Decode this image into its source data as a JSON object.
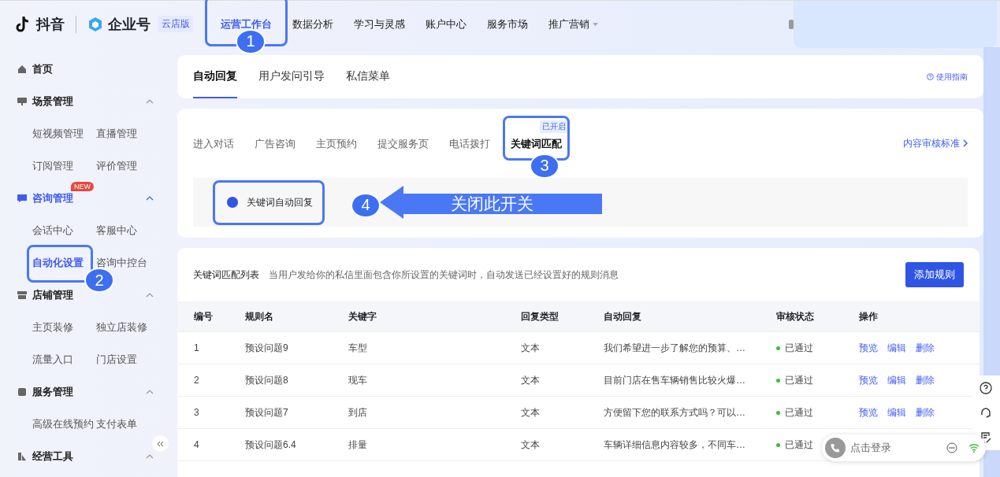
{
  "header": {
    "logo": "抖音",
    "brand": "企业号",
    "edition": "云店版",
    "nav": [
      {
        "label": "运营工作台",
        "selected": true,
        "callout": "1"
      },
      {
        "label": "数据分析",
        "selected": false
      },
      {
        "label": "学习与灵感",
        "selected": false
      },
      {
        "label": "账户中心",
        "selected": false
      },
      {
        "label": "服务市场",
        "selected": false
      },
      {
        "label": "推广营销",
        "selected": false,
        "dropdown": true
      }
    ]
  },
  "sidebar": {
    "items": [
      {
        "label": "首页",
        "selected": false
      },
      {
        "label": "场景管理",
        "selected": false,
        "expanded": true,
        "children": [
          {
            "label": "短视频管理",
            "selected": false
          },
          {
            "label": "直播管理",
            "selected": false
          },
          {
            "label": "订阅管理",
            "selected": false
          },
          {
            "label": "评价管理",
            "selected": false
          }
        ]
      },
      {
        "label": "咨询管理",
        "selected": true,
        "badge": "NEW",
        "expanded": true,
        "children": [
          {
            "label": "会话中心",
            "selected": false
          },
          {
            "label": "客服中心",
            "selected": false
          },
          {
            "label": "自动化设置",
            "selected": true,
            "callout": "2"
          },
          {
            "label": "咨询中控台",
            "selected": false
          }
        ]
      },
      {
        "label": "店铺管理",
        "selected": false,
        "expanded": true,
        "children": [
          {
            "label": "主页装修",
            "selected": false
          },
          {
            "label": "独立店装修",
            "selected": false
          },
          {
            "label": "流量入口",
            "selected": false
          },
          {
            "label": "门店设置",
            "selected": false
          }
        ]
      },
      {
        "label": "服务管理",
        "selected": false,
        "expanded": true,
        "children": [
          {
            "label": "高级在线预约",
            "selected": false
          },
          {
            "label": "支付表单",
            "selected": false
          }
        ]
      },
      {
        "label": "经营工具",
        "selected": false,
        "expanded": true
      }
    ]
  },
  "main_tabs": {
    "tabs": [
      {
        "label": "自动回复",
        "selected": true
      },
      {
        "label": "用户发问引导",
        "selected": false
      },
      {
        "label": "私信菜单",
        "selected": false
      }
    ],
    "guide_link": "使用指南"
  },
  "sub_tabs": {
    "tabs": [
      {
        "label": "进入对话",
        "selected": false
      },
      {
        "label": "广告咨询",
        "selected": false
      },
      {
        "label": "主页预约",
        "selected": false
      },
      {
        "label": "提交服务页",
        "selected": false
      },
      {
        "label": "电话拨打",
        "selected": false
      },
      {
        "label": "关键词匹配",
        "selected": true,
        "badge": "已开启",
        "callout": "3"
      }
    ],
    "review_link": "内容审核标准"
  },
  "toggle": {
    "label": "关键词自动回复",
    "on": true,
    "callout": "4",
    "note": "关闭此开关"
  },
  "table": {
    "title": "关键词匹配列表",
    "description": "当用户发给你的私信里面包含你所设置的关键词时，自动发送已经设置好的规则消息",
    "add_button": "添加规则",
    "columns": [
      "编号",
      "规则名",
      "关键字",
      "回复类型",
      "自动回复",
      "审核状态",
      "操作"
    ],
    "rows": [
      {
        "cells": [
          "1",
          "预设问题9",
          "车型",
          "文本",
          "我们希望进一步了解您的预算、…"
        ],
        "status": "已通过",
        "actions": [
          "预览",
          "编辑",
          "删除"
        ]
      },
      {
        "cells": [
          "2",
          "预设问题8",
          "现车",
          "文本",
          "目前门店在售车辆销售比较火爆…"
        ],
        "status": "已通过",
        "actions": [
          "预览",
          "编辑",
          "删除"
        ]
      },
      {
        "cells": [
          "3",
          "预设问题7",
          "到店",
          "文本",
          "方便留下您的联系方式吗？可以…"
        ],
        "status": "已通过",
        "actions": [
          "预览",
          "编辑",
          "删除"
        ]
      },
      {
        "cells": [
          "4",
          "预设问题6.4",
          "排量",
          "文本",
          "车辆详细信息内容较多，不同车…"
        ],
        "status": "已通过"
      }
    ]
  },
  "login_widget": {
    "label": "点击登录"
  }
}
